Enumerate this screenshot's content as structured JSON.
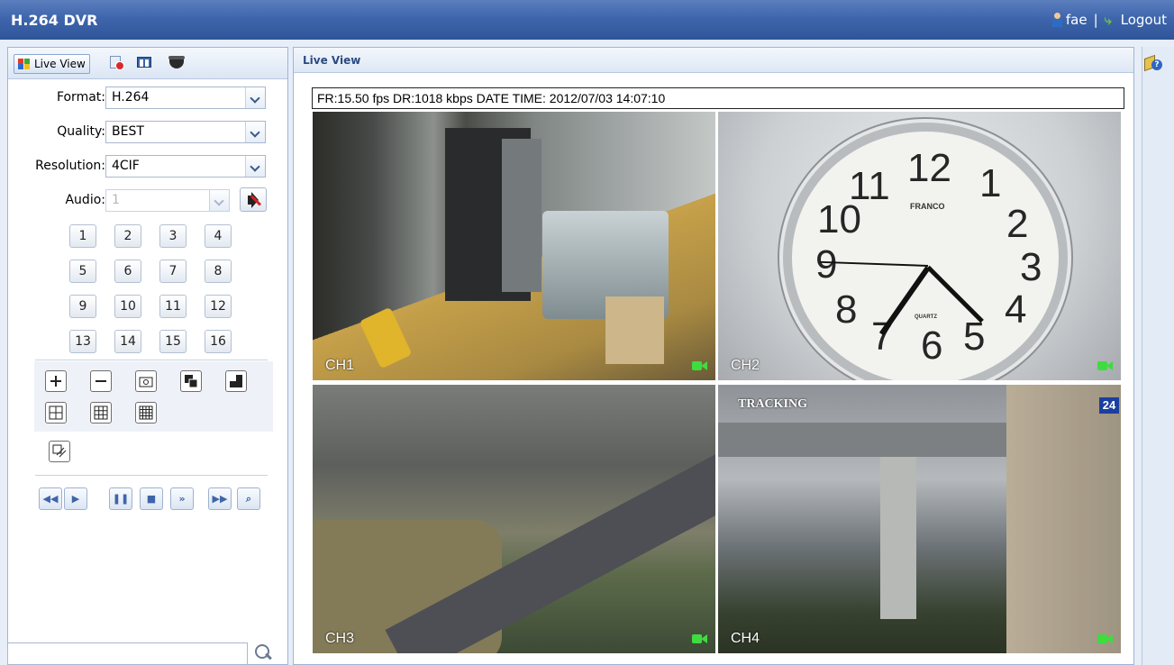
{
  "header": {
    "app_title": "H.264 DVR",
    "username": "fae",
    "separator": "|",
    "logout_label": "Logout"
  },
  "left_panel": {
    "tab_live_label": "Live View",
    "format": {
      "label": "Format:",
      "value": "H.264"
    },
    "quality": {
      "label": "Quality:",
      "value": "BEST"
    },
    "resolution": {
      "label": "Resolution:",
      "value": "4CIF"
    },
    "audio": {
      "label": "Audio:",
      "value": "1"
    },
    "channels": [
      "1",
      "2",
      "3",
      "4",
      "5",
      "6",
      "7",
      "8",
      "9",
      "10",
      "11",
      "12",
      "13",
      "14",
      "15",
      "16"
    ],
    "search_placeholder": ""
  },
  "main": {
    "title": "Live View",
    "status_text": "FR:15.50 fps  DR:1018 kbps  DATE TIME: 2012/07/03 14:07:10",
    "videos": [
      {
        "label": "CH1"
      },
      {
        "label": "CH2",
        "clock_brand": "FRANCO",
        "clock_quartz": "QUARTZ"
      },
      {
        "label": "CH3"
      },
      {
        "label": "CH4",
        "overlay_text": "TRACKING",
        "overlay_number": "24"
      }
    ],
    "clock_numbers": [
      "12",
      "1",
      "2",
      "3",
      "4",
      "5",
      "6",
      "7",
      "8",
      "9",
      "10",
      "11"
    ]
  },
  "icons": {
    "user": "user-icon",
    "logout": "logout-icon",
    "record": "record-icon",
    "network": "network-icon",
    "camera": "dome-camera-icon",
    "mute": "mute-icon",
    "search": "search-icon",
    "help": "help-icon"
  }
}
